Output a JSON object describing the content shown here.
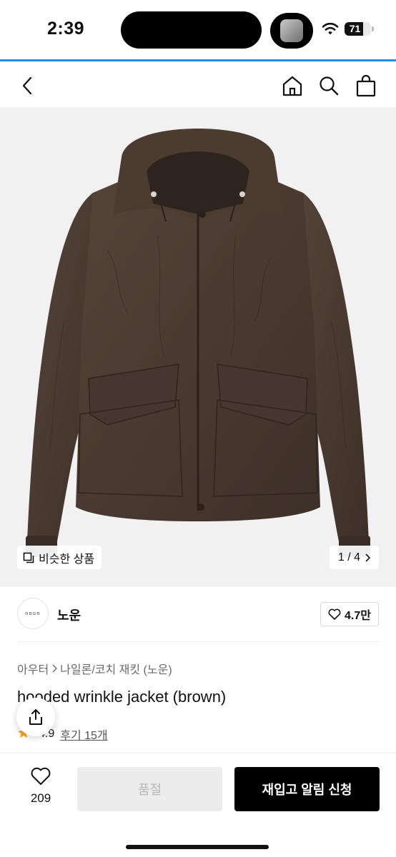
{
  "status_bar": {
    "time": "2:39",
    "battery_level": "71",
    "battery_fraction": 0.71
  },
  "nav": {
    "back_icon": "chevron-left-icon",
    "home_icon": "home-icon",
    "search_icon": "search-icon",
    "cart_icon": "shopping-bag-icon"
  },
  "hero": {
    "image_description": "brown hooded wrinkle jacket",
    "similar_label": "비슷한 상품",
    "pager": "1 / 4"
  },
  "brand": {
    "logo_text": "noun",
    "name": "노운",
    "likes": "4.7만"
  },
  "product": {
    "breadcrumb": [
      "아우터",
      "나일론/코치 재킷 (노운)"
    ],
    "title": "hooded wrinkle jacket (brown)",
    "rating": "4.9",
    "reviews": "후기 15개"
  },
  "bottom": {
    "wish_count": "209",
    "soldout_label": "품절",
    "restock_label": "재입고 알림 신청"
  },
  "colors": {
    "accent": "#1e8df0",
    "jacket": "#4a3a30",
    "star": "#f5a623"
  }
}
